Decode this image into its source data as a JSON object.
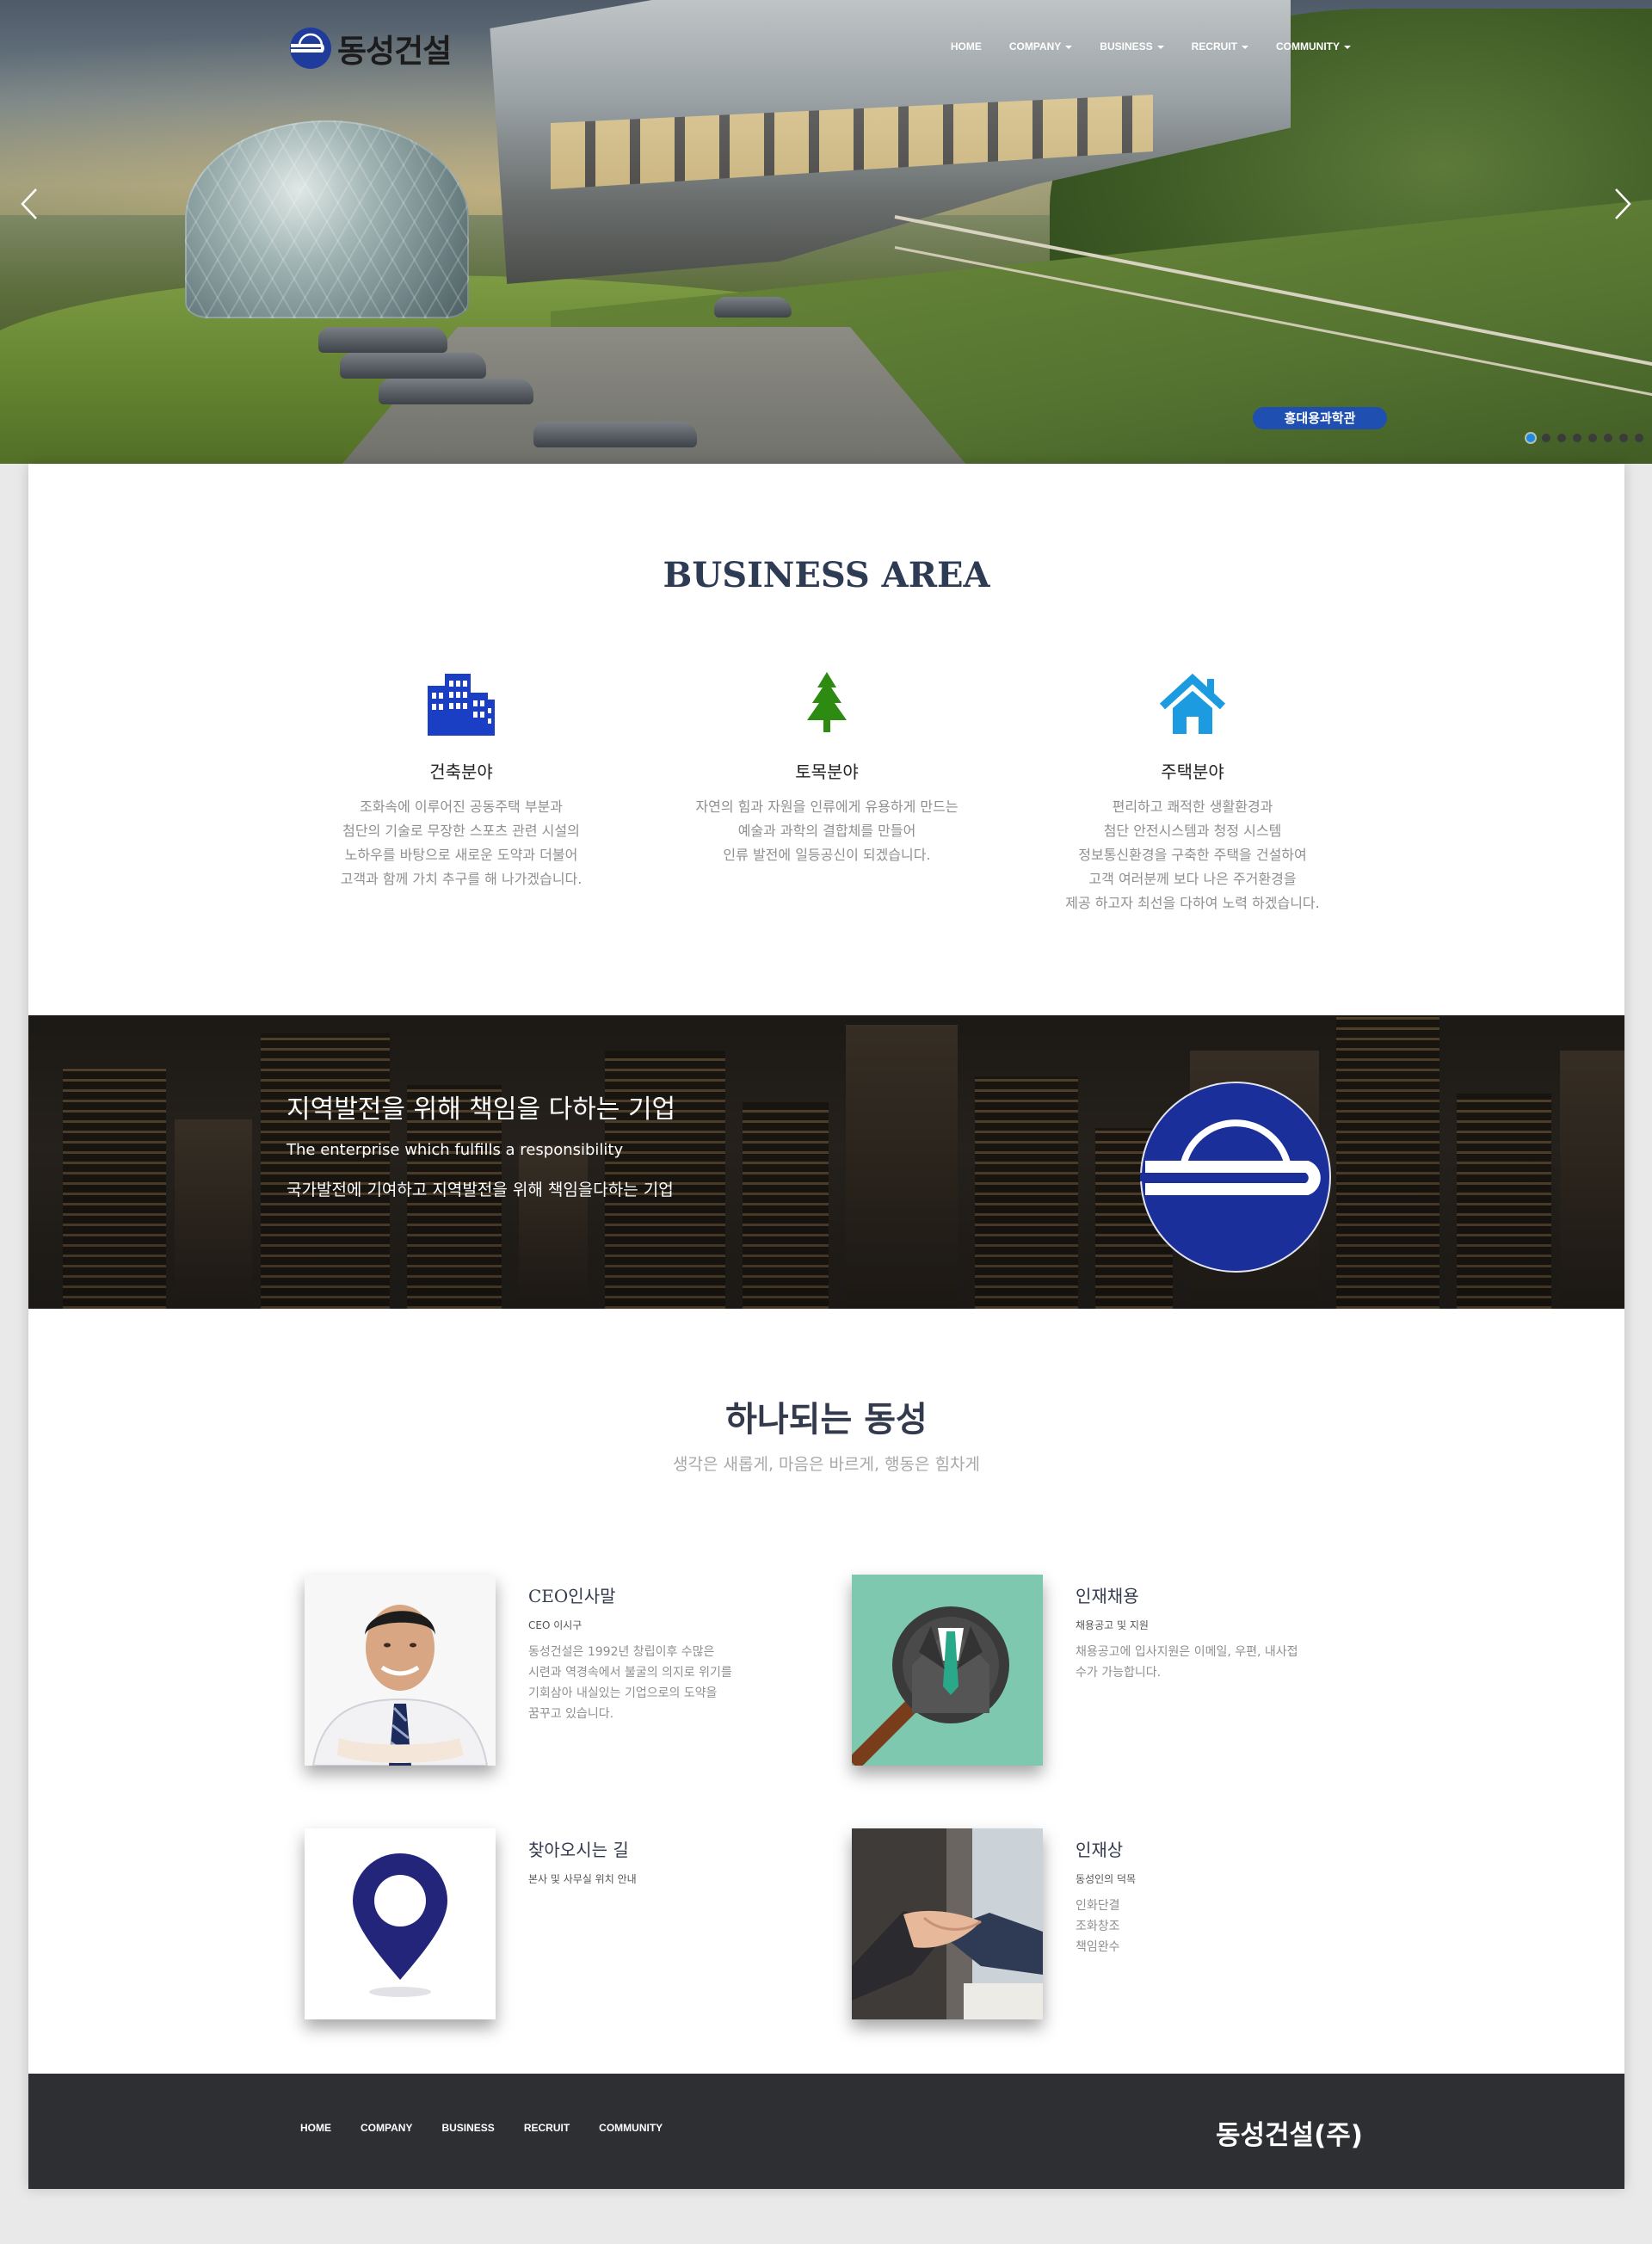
{
  "brand": {
    "name": "동성건설",
    "color": "#1f3c9c"
  },
  "nav": {
    "items": [
      {
        "label": "HOME",
        "dropdown": false
      },
      {
        "label": "COMPANY",
        "dropdown": true
      },
      {
        "label": "BUSINESS",
        "dropdown": true
      },
      {
        "label": "RECRUIT",
        "dropdown": true
      },
      {
        "label": "COMMUNITY",
        "dropdown": true
      }
    ]
  },
  "slider": {
    "caption": "홍대용과학관",
    "slide_count": 8,
    "active_index": 0,
    "prev_icon": "chevron-left-icon",
    "next_icon": "chevron-right-icon"
  },
  "business": {
    "title": "BUSINESS AREA",
    "items": [
      {
        "icon": "building-icon",
        "icon_color": "#1a3fc4",
        "title": "건축분야",
        "lines": [
          "조화속에 이루어진 공동주택 부분과",
          "첨단의 기술로 무장한 스포츠 관련 시설의",
          "노하우를 바탕으로 새로운 도약과 더불어",
          "고객과 함께 가치 추구를 해 나가겠습니다."
        ]
      },
      {
        "icon": "tree-icon",
        "icon_color": "#2e8b12",
        "title": "토목분야",
        "lines": [
          "자연의 힘과 자원을 인류에게 유용하게 만드는",
          "예술과 과학의 결합체를 만들어",
          "인류 발전에 일등공신이 되겠습니다."
        ]
      },
      {
        "icon": "house-icon",
        "icon_color": "#1d9be0",
        "title": "주택분야",
        "lines": [
          "편리하고 쾌적한 생활환경과",
          "첨단 안전시스템과 청정 시스템",
          "정보통신환경을 구축한 주택을 건설하여",
          "고객 여러분께 보다 나은 주거환경을",
          "제공 하고자 최선을 다하여 노력 하겠습니다."
        ]
      }
    ]
  },
  "banner": {
    "title": "지역발전을 위해 책임을 다하는 기업",
    "subtitle": "The enterprise which fulfills a responsibility",
    "text": "국가발전에 기여하고 지역발전을 위해 책임을다하는 기업"
  },
  "one": {
    "title": "하나되는 동성",
    "subtitle": "생각은 새롭게, 마음은 바르게, 행동은 힘차게"
  },
  "cards": {
    "ceo": {
      "title": "CEO인사말",
      "sub": "CEO 이시구",
      "lines": [
        "동성건설은 1992년 창립이후 수많은",
        "시련과 역경속에서 불굴의 의지로 위기를",
        "기회삼아 내실있는 기업으로의 도약을",
        "꿈꾸고 있습니다."
      ]
    },
    "recruit": {
      "title": "인재채용",
      "sub": "채용공고 및 지원",
      "lines": [
        "채용공고에 입사지원은 이메일, 우편, 내사접",
        "수가 가능합니다."
      ]
    },
    "location": {
      "title": "찾아오시는 길",
      "sub": "본사 및 사무실 위치 안내",
      "lines": []
    },
    "talent": {
      "title": "인재상",
      "sub": "동성인의 덕목",
      "lines": [
        "인화단결",
        "조화창조",
        "책임완수"
      ]
    }
  },
  "footer": {
    "links": [
      "HOME",
      "COMPANY",
      "BUSINESS",
      "RECRUIT",
      "COMMUNITY"
    ],
    "brand": "동성건설(주)"
  }
}
